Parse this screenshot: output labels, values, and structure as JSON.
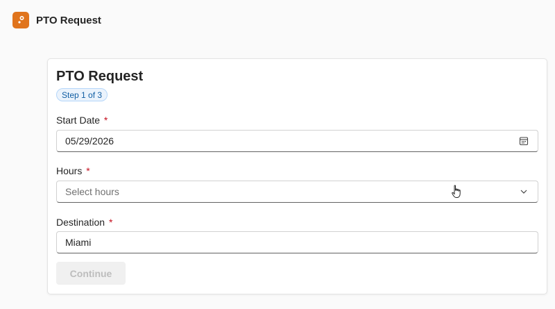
{
  "app": {
    "title": "PTO Request",
    "accent_color": "#e0741c",
    "logo_icon": "app-logo-icon"
  },
  "form": {
    "title": "PTO Request",
    "step_badge": "Step 1 of 3",
    "required_marker": "*",
    "fields": {
      "start_date": {
        "label": "Start Date",
        "value": "05/29/2026",
        "icon": "calendar-icon"
      },
      "hours": {
        "label": "Hours",
        "placeholder": "Select hours",
        "icon": "chevron-down-icon"
      },
      "destination": {
        "label": "Destination",
        "value": "Miami"
      }
    },
    "continue_label": "Continue",
    "continue_enabled": false
  },
  "colors": {
    "required": "#c50f1f",
    "badge_text": "#115ea3",
    "badge_bg": "#ebf3fc",
    "disabled_button_bg": "#f0f0f0",
    "disabled_button_text": "#bdbdbd"
  }
}
